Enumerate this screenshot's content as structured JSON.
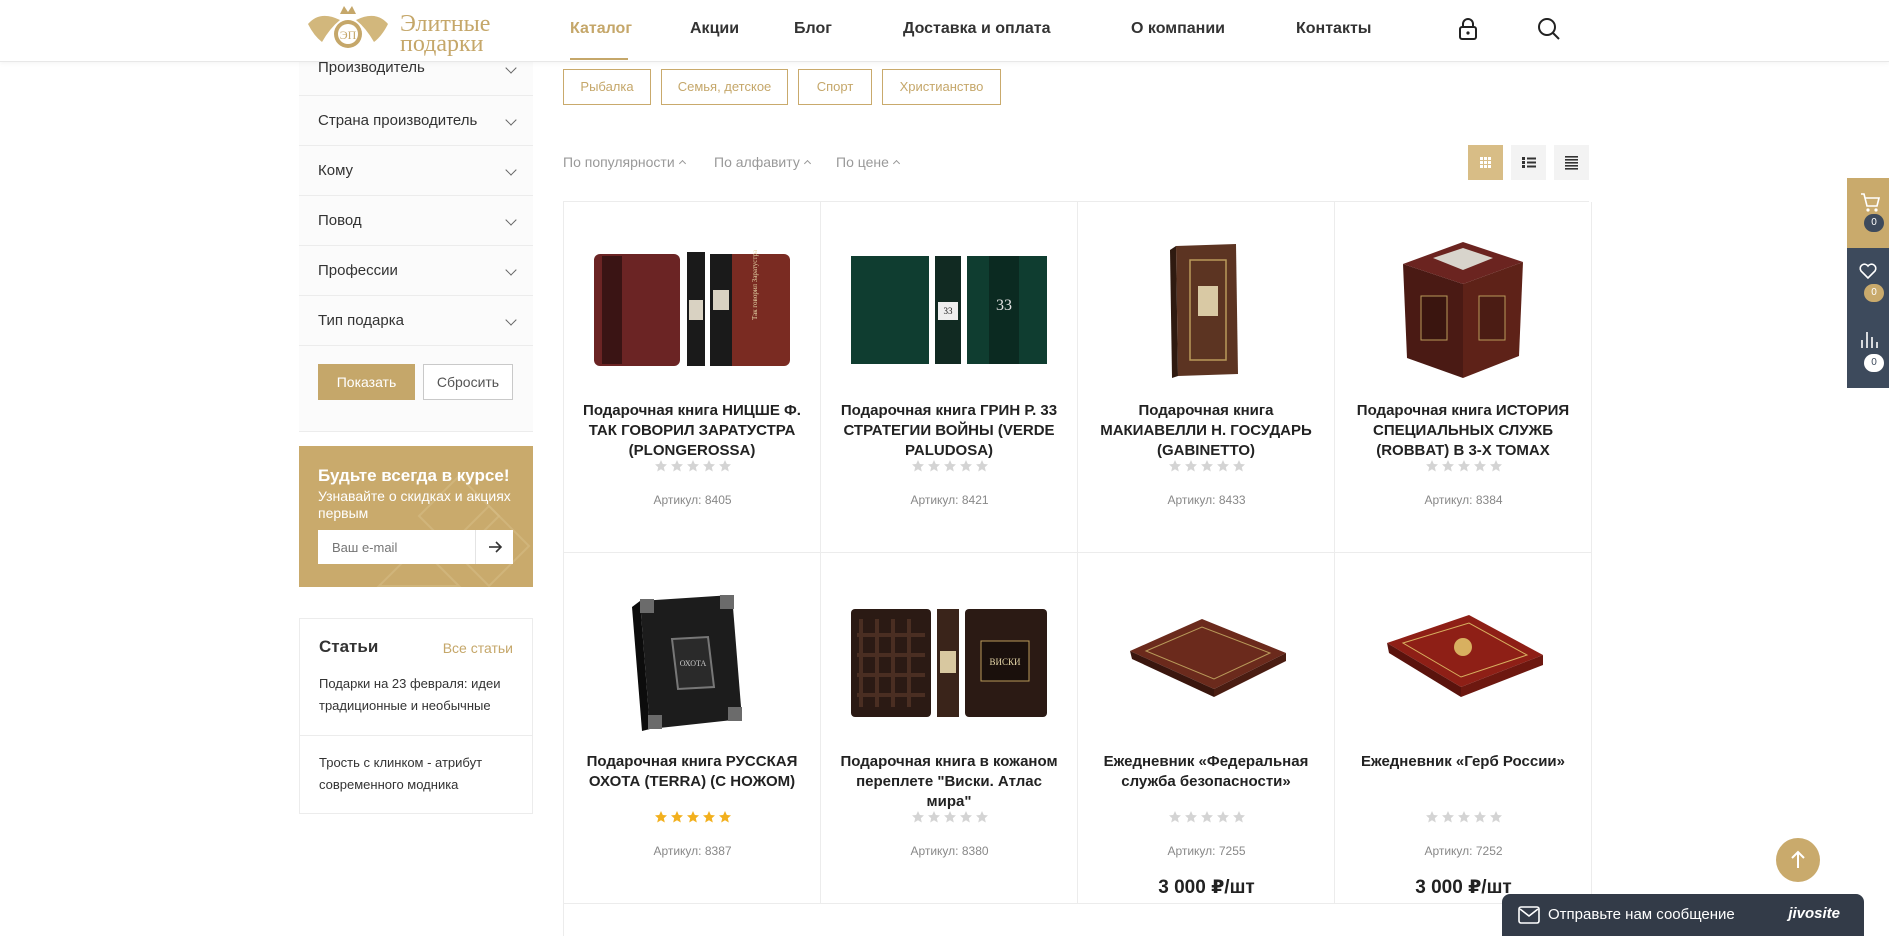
{
  "header": {
    "logo_text_line1": "Элитные",
    "logo_text_line2": "подарки",
    "nav": [
      {
        "label": "Каталог",
        "active": true
      },
      {
        "label": "Акции"
      },
      {
        "label": "Блог"
      },
      {
        "label": "Доставка и оплата"
      },
      {
        "label": "О компании"
      },
      {
        "label": "Контакты"
      }
    ],
    "icons": [
      "lock-icon",
      "search-icon"
    ]
  },
  "sidebar": {
    "filters": [
      "Производитель",
      "Страна производитель",
      "Кому",
      "Повод",
      "Профессии",
      "Тип подарка"
    ],
    "show_button": "Показать",
    "reset_button": "Сбросить"
  },
  "subscribe": {
    "title": "Будьте всегда в курсе!",
    "text": "Узнавайте о скидках и акциях первым",
    "email_placeholder": "Ваш e-mail"
  },
  "articles": {
    "title": "Статьи",
    "all_link": "Все статьи",
    "items": [
      "Подарки на 23 февраля: идеи традиционные и необычные",
      "Трость с клинком - атрибут современного модника"
    ]
  },
  "tags": [
    "Рыбалка",
    "Семья, детское",
    "Спорт",
    "Христианство"
  ],
  "sort": [
    "По популярности",
    "По алфавиту",
    "По цене"
  ],
  "view_modes": [
    "grid-view-icon",
    "list-view-icon",
    "table-view-icon"
  ],
  "products": [
    {
      "title": "Подарочная книга НИЦШЕ Ф. ТАК ГОВОРИЛ ЗАРАТУСТРА (PLONGEROSSA)",
      "sku": "Артикул: 8405",
      "rating": 0,
      "price": ""
    },
    {
      "title": "Подарочная книга ГРИН Р. 33 СТРАТЕГИИ ВОЙНЫ (VERDE PALUDOSA)",
      "sku": "Артикул: 8421",
      "rating": 0,
      "price": ""
    },
    {
      "title": "Подарочная книга МАКИАВЕЛЛИ Н. ГОСУДАРЬ (GABINETTO)",
      "sku": "Артикул: 8433",
      "rating": 0,
      "price": ""
    },
    {
      "title": "Подарочная книга ИСТОРИЯ СПЕЦИАЛЬНЫХ СЛУЖБ (ROBBAT) В 3-Х ТОМАХ",
      "sku": "Артикул: 8384",
      "rating": 0,
      "price": ""
    },
    {
      "title": "Подарочная книга РУССКАЯ ОХОТА (TERRA) (С НОЖОМ)",
      "sku": "Артикул: 8387",
      "rating": 5,
      "price": ""
    },
    {
      "title": "Подарочная книга в кожаном переплете \"Виски. Атлас мира\"",
      "sku": "Артикул: 8380",
      "rating": 0,
      "price": ""
    },
    {
      "title": "Ежедневник «Федеральная служба безопасности»",
      "sku": "Артикул: 7255",
      "rating": 0,
      "price": "3 000 ₽/шт"
    },
    {
      "title": "Ежедневник «Герб России»",
      "sku": "Артикул: 7252",
      "rating": 0,
      "price": "3 000 ₽/шт"
    }
  ],
  "side_panel": {
    "cart_count": "0",
    "favorites_count": "0",
    "compare_count": "0"
  },
  "chat": {
    "label": "Отправьте нам сообщение",
    "brand": "jivosite"
  },
  "colors": {
    "accent": "#c5a76a",
    "panel_dark": "#3d4a5c",
    "text": "#222222"
  }
}
